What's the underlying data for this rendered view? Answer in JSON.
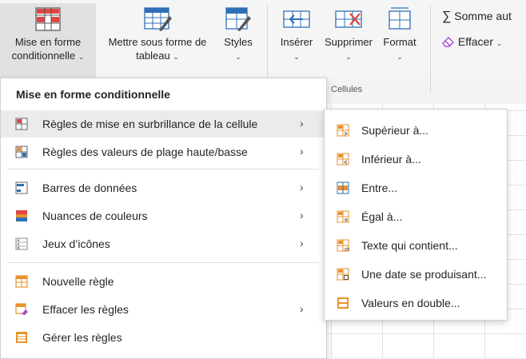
{
  "ribbon": {
    "buttons": [
      {
        "line1": "Mise en forme",
        "line2": "conditionnelle"
      },
      {
        "line1": "Mettre sous forme de",
        "line2": "tableau"
      },
      {
        "line1": "Styles",
        "line2": ""
      },
      {
        "line1": "Insérer",
        "line2": ""
      },
      {
        "line1": "Supprimer",
        "line2": ""
      },
      {
        "line1": "Format",
        "line2": ""
      }
    ],
    "group_label": "Cellules",
    "autosum_label": "Somme aut",
    "autosum_symbol": "∑",
    "clear_label": "Effacer"
  },
  "menu": {
    "title": "Mise en forme conditionnelle",
    "items": [
      {
        "label": "Règles de mise en surbrillance de la cellule",
        "icon": "highlight-rules-icon",
        "has_submenu": true
      },
      {
        "label": "Règles des valeurs de plage haute/basse",
        "icon": "top-bottom-rules-icon",
        "has_submenu": true
      },
      {
        "label": "Barres de données",
        "icon": "data-bars-icon",
        "has_submenu": true
      },
      {
        "label": "Nuances de couleurs",
        "icon": "color-scales-icon",
        "has_submenu": true
      },
      {
        "label": "Jeux d’icônes",
        "icon": "icon-sets-icon",
        "has_submenu": true
      },
      {
        "label": "Nouvelle règle",
        "icon": "new-rule-icon",
        "has_submenu": false
      },
      {
        "label": "Effacer les règles",
        "icon": "clear-rules-icon",
        "has_submenu": true
      },
      {
        "label": "Gérer les règles",
        "icon": "manage-rules-icon",
        "has_submenu": false
      }
    ],
    "arrow": "›"
  },
  "submenu": {
    "items": [
      {
        "label": "Supérieur à..."
      },
      {
        "label": "Inférieur à..."
      },
      {
        "label": "Entre..."
      },
      {
        "label": "Égal à..."
      },
      {
        "label": "Texte qui contient..."
      },
      {
        "label": "Une date se produisant..."
      },
      {
        "label": "Valeurs en double..."
      }
    ]
  },
  "colors": {
    "accent_red": "#e04646",
    "accent_blue": "#2e6fb7",
    "accent_orange": "#e8912d",
    "hover_bg": "#ebebeb"
  }
}
